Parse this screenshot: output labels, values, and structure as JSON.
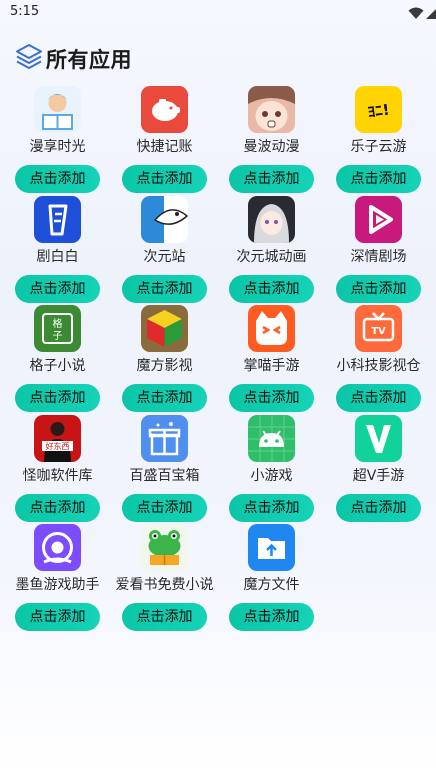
{
  "status_bar": {
    "time": "5:15",
    "icons": [
      "wifi-icon",
      "signal-icon",
      "battery-icon"
    ]
  },
  "header": {
    "title": "所有应用",
    "icon": "layers-icon"
  },
  "add_button_label": "点击添加",
  "apps": [
    {
      "name": "漫享时光",
      "icon": "boy-reading-icon",
      "color": "#5aa9e8"
    },
    {
      "name": "快捷记账",
      "icon": "piggy-bank-icon",
      "color": "#e94a3b"
    },
    {
      "name": "曼波动漫",
      "icon": "anime-face-icon",
      "color": "#e9b9a8"
    },
    {
      "name": "乐子云游",
      "icon": "lezi-logo-icon",
      "color": "#ffd400"
    },
    {
      "name": "剧白白",
      "icon": "jubaibai-logo-icon",
      "color": "#1d4fd8"
    },
    {
      "name": "次元站",
      "icon": "ciyuan-fish-icon",
      "color": "#2c8ad9"
    },
    {
      "name": "次元城动画",
      "icon": "anime-girl-icon",
      "color": "#d9d9de"
    },
    {
      "name": "深情剧场",
      "icon": "play-triangle-icon",
      "color": "#c8197d"
    },
    {
      "name": "格子小说",
      "icon": "gezi-book-icon",
      "color": "#3d8a34"
    },
    {
      "name": "魔方影视",
      "icon": "rubiks-cube-icon",
      "color": "#8a6b3e"
    },
    {
      "name": "掌喵手游",
      "icon": "cat-face-icon",
      "color": "#ff5a1f"
    },
    {
      "name": "小科技影视仓",
      "icon": "tv-icon",
      "color": "#ff6a3c"
    },
    {
      "name": "怪咖软件库",
      "icon": "person-sign-icon",
      "color": "#c81414"
    },
    {
      "name": "百盛百宝箱",
      "icon": "gift-box-icon",
      "color": "#4f8ff0"
    },
    {
      "name": "小游戏",
      "icon": "android-icon",
      "color": "#2fbf6a"
    },
    {
      "name": "超V手游",
      "icon": "v-letter-icon",
      "color": "#12d29b"
    },
    {
      "name": "墨鱼游戏助手",
      "icon": "face-circle-icon",
      "color": "#7c4dff"
    },
    {
      "name": "爱看书免费小说",
      "icon": "frog-book-icon",
      "color": "#f2f7ee"
    },
    {
      "name": "魔方文件",
      "icon": "cloud-folder-icon",
      "color": "#1e88f0"
    }
  ]
}
